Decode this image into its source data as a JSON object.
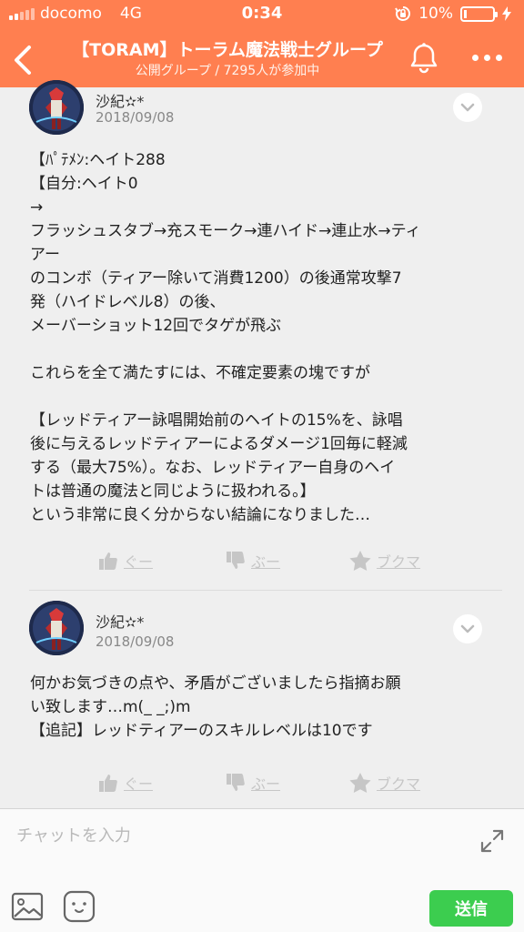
{
  "status_bar": {
    "carrier": "docomo",
    "network": "4G",
    "time": "0:34",
    "battery": "10%",
    "battery_level": 0.1
  },
  "header": {
    "title": "【TORAM】トーラム魔法戦士グループ",
    "subtitle": "公開グループ / 7295人が参加中"
  },
  "posts": [
    {
      "author": "沙紀✫*",
      "date": "2018/09/08",
      "lines": [
        "【ﾊﾟﾃﾒﾝ:ヘイト288",
        "【自分:ヘイト0",
        "→",
        "フラッシュスタブ→充スモーク→連ハイド→連止水→ティ",
        "アー",
        "のコンボ（ティアー除いて消費1200）の後通常攻撃7",
        "発（ハイドレベル8）の後、",
        "メーバーショット12回でタゲが飛ぶ",
        "",
        "これらを全て満たすには、不確定要素の塊ですが",
        "",
        "【レッドティアー詠唱開始前のヘイトの15%を、詠唱",
        "後に与えるレッドティアーによるダメージ1回毎に軽減",
        "する（最大75%）。なお、レッドティアー自身のヘイ",
        "トは普通の魔法と同じように扱われる。】",
        "という非常に良く分からない結論になりました…"
      ],
      "actions": {
        "good": "ぐー",
        "boo": "ぶー",
        "bookmark": "ブクマ"
      }
    },
    {
      "author": "沙紀✫*",
      "date": "2018/09/08",
      "lines": [
        "何かお気づきの点や、矛盾がございましたら指摘お願",
        "い致します…m(_ _;)m",
        "【追記】レッドティアーのスキルレベルは10です"
      ],
      "actions": {
        "good": "ぐー",
        "boo": "ぶー",
        "bookmark": "ブクマ"
      }
    }
  ],
  "input": {
    "placeholder": "チャットを入力",
    "send_label": "送信"
  },
  "colors": {
    "header_bg": "#ff7f50",
    "send_bg": "#3ccd4f",
    "action_gray": "#c6c6c6"
  },
  "icons": [
    "back-icon",
    "bell-icon",
    "more-icon",
    "chevron-down-icon",
    "thumbs-up-icon",
    "thumbs-down-icon",
    "star-icon",
    "expand-icon",
    "image-icon",
    "sticker-icon"
  ]
}
